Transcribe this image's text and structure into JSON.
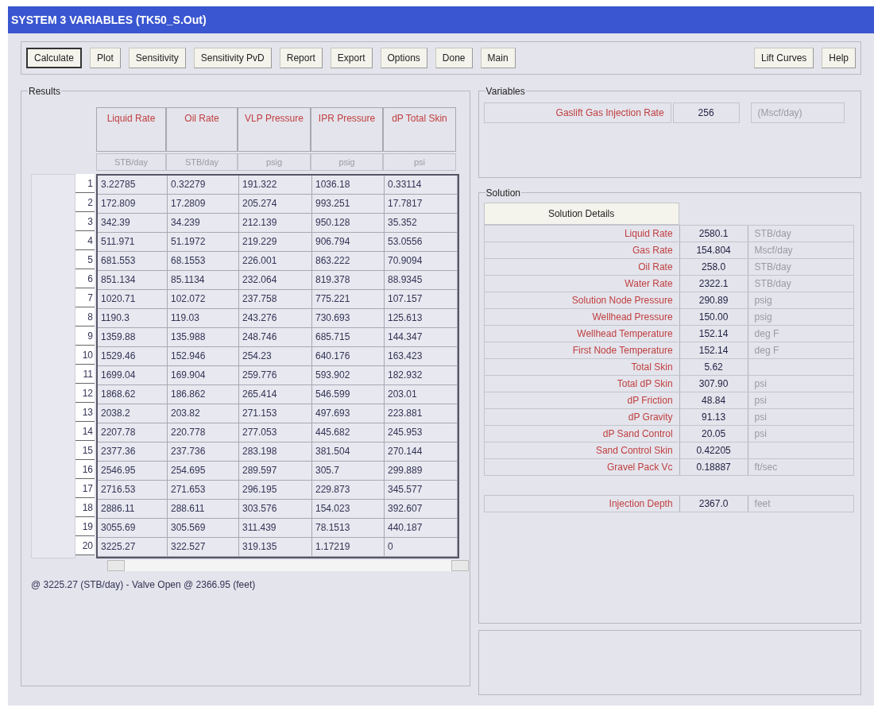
{
  "window": {
    "title": "SYSTEM 3 VARIABLES (TK50_S.Out)"
  },
  "toolbar": {
    "left": [
      {
        "label": "Calculate",
        "default": true
      },
      {
        "label": "Plot",
        "default": false
      },
      {
        "label": "Sensitivity",
        "default": false
      },
      {
        "label": "Sensitivity PvD",
        "default": false
      },
      {
        "label": "Report",
        "default": false
      },
      {
        "label": "Export",
        "default": false
      },
      {
        "label": "Options",
        "default": false
      },
      {
        "label": "Done",
        "default": false
      },
      {
        "label": "Main",
        "default": false
      }
    ],
    "right": [
      {
        "label": "Lift Curves",
        "default": false
      },
      {
        "label": "Help",
        "default": false
      }
    ]
  },
  "results": {
    "title": "Results",
    "columns": [
      {
        "label": "Liquid Rate",
        "unit": "STB/day"
      },
      {
        "label": "Oil Rate",
        "unit": "STB/day"
      },
      {
        "label": "VLP Pressure",
        "unit": "psig"
      },
      {
        "label": "IPR Pressure",
        "unit": "psig"
      },
      {
        "label": "dP Total Skin",
        "unit": "psi"
      }
    ],
    "rows": [
      {
        "index": "1",
        "cells": [
          "3.22785",
          "0.32279",
          "191.322",
          "1036.18",
          "0.33114"
        ]
      },
      {
        "index": "2",
        "cells": [
          "172.809",
          "17.2809",
          "205.274",
          "993.251",
          "17.7817"
        ]
      },
      {
        "index": "3",
        "cells": [
          "342.39",
          "34.239",
          "212.139",
          "950.128",
          "35.352"
        ]
      },
      {
        "index": "4",
        "cells": [
          "511.971",
          "51.1972",
          "219.229",
          "906.794",
          "53.0556"
        ]
      },
      {
        "index": "5",
        "cells": [
          "681.553",
          "68.1553",
          "226.001",
          "863.222",
          "70.9094"
        ]
      },
      {
        "index": "6",
        "cells": [
          "851.134",
          "85.1134",
          "232.064",
          "819.378",
          "88.9345"
        ]
      },
      {
        "index": "7",
        "cells": [
          "1020.71",
          "102.072",
          "237.758",
          "775.221",
          "107.157"
        ]
      },
      {
        "index": "8",
        "cells": [
          "1190.3",
          "119.03",
          "243.276",
          "730.693",
          "125.613"
        ]
      },
      {
        "index": "9",
        "cells": [
          "1359.88",
          "135.988",
          "248.746",
          "685.715",
          "144.347"
        ]
      },
      {
        "index": "10",
        "cells": [
          "1529.46",
          "152.946",
          "254.23",
          "640.176",
          "163.423"
        ]
      },
      {
        "index": "11",
        "cells": [
          "1699.04",
          "169.904",
          "259.776",
          "593.902",
          "182.932"
        ]
      },
      {
        "index": "12",
        "cells": [
          "1868.62",
          "186.862",
          "265.414",
          "546.599",
          "203.01"
        ]
      },
      {
        "index": "13",
        "cells": [
          "2038.2",
          "203.82",
          "271.153",
          "497.693",
          "223.881"
        ]
      },
      {
        "index": "14",
        "cells": [
          "2207.78",
          "220.778",
          "277.053",
          "445.682",
          "245.953"
        ]
      },
      {
        "index": "15",
        "cells": [
          "2377.36",
          "237.736",
          "283.198",
          "381.504",
          "270.144"
        ]
      },
      {
        "index": "16",
        "cells": [
          "2546.95",
          "254.695",
          "289.597",
          "305.7",
          "299.889"
        ]
      },
      {
        "index": "17",
        "cells": [
          "2716.53",
          "271.653",
          "296.195",
          "229.873",
          "345.577"
        ]
      },
      {
        "index": "18",
        "cells": [
          "2886.11",
          "288.611",
          "303.576",
          "154.023",
          "392.607"
        ]
      },
      {
        "index": "19",
        "cells": [
          "3055.69",
          "305.569",
          "311.439",
          "78.1513",
          "440.187"
        ]
      },
      {
        "index": "20",
        "cells": [
          "3225.27",
          "322.527",
          "319.135",
          "1.17219",
          "0"
        ]
      }
    ],
    "status": "@ 3225.27 (STB/day) - Valve Open @ 2366.95 (feet)"
  },
  "variables": {
    "title": "Variables",
    "items": [
      {
        "label": "Gaslift Gas Injection Rate",
        "value": "256",
        "unit": "(Mscf/day)"
      }
    ]
  },
  "solution": {
    "title": "Solution",
    "details_button": "Solution Details",
    "rows": [
      {
        "label": "Liquid Rate",
        "value": "2580.1",
        "unit": "STB/day"
      },
      {
        "label": "Gas Rate",
        "value": "154.804",
        "unit": "Mscf/day"
      },
      {
        "label": "Oil Rate",
        "value": "258.0",
        "unit": "STB/day"
      },
      {
        "label": "Water Rate",
        "value": "2322.1",
        "unit": "STB/day"
      },
      {
        "label": "Solution Node Pressure",
        "value": "290.89",
        "unit": "psig"
      },
      {
        "label": "Wellhead Pressure",
        "value": "150.00",
        "unit": "psig"
      },
      {
        "label": "Wellhead Temperature",
        "value": "152.14",
        "unit": "deg F"
      },
      {
        "label": "First Node Temperature",
        "value": "152.14",
        "unit": "deg F"
      },
      {
        "label": "Total Skin",
        "value": "5.62"
      },
      {
        "label": "Total dP Skin",
        "value": "307.90",
        "unit": "psi"
      },
      {
        "label": "dP Friction",
        "value": "48.84",
        "unit": "psi"
      },
      {
        "label": "dP Gravity",
        "value": "91.13",
        "unit": "psi"
      },
      {
        "label": "dP Sand Control",
        "value": "20.05",
        "unit": "psi"
      },
      {
        "label": "Sand Control Skin",
        "value": "0.42205"
      },
      {
        "label": "Gravel Pack Vc",
        "value": "0.18887",
        "unit": "ft/sec"
      }
    ],
    "injection": {
      "label": "Injection Depth",
      "value": "2367.0",
      "unit": "feet"
    }
  }
}
